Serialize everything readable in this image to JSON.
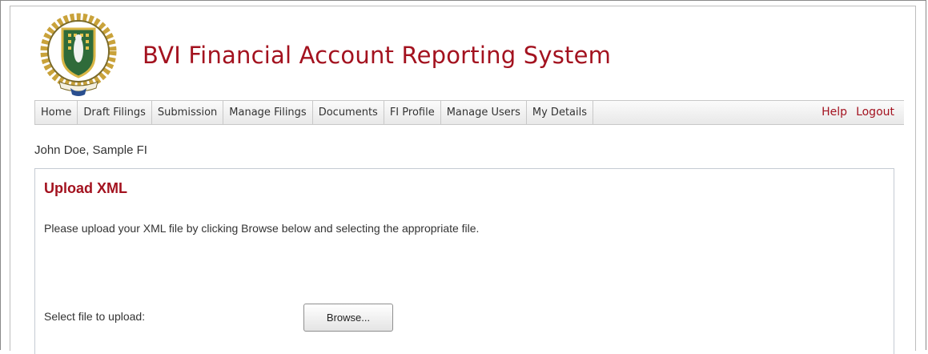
{
  "header": {
    "title": "BVI Financial Account Reporting System",
    "logo_name": "bvi-coat-of-arms"
  },
  "nav": {
    "items": [
      {
        "label": "Home"
      },
      {
        "label": "Draft Filings"
      },
      {
        "label": "Submission"
      },
      {
        "label": "Manage Filings"
      },
      {
        "label": "Documents"
      },
      {
        "label": "FI Profile"
      },
      {
        "label": "Manage Users"
      },
      {
        "label": "My Details"
      }
    ],
    "help_label": "Help",
    "logout_label": "Logout"
  },
  "user": {
    "line": "John Doe, Sample FI"
  },
  "panel": {
    "title": "Upload XML",
    "instructions": "Please upload your XML file by clicking Browse below and selecting the appropriate file.",
    "file_label": "Select file to upload:",
    "browse_label": "Browse..."
  },
  "colors": {
    "brand": "#a3121f",
    "nav_border": "#c8c8c8",
    "panel_border": "#c5cbd3"
  }
}
